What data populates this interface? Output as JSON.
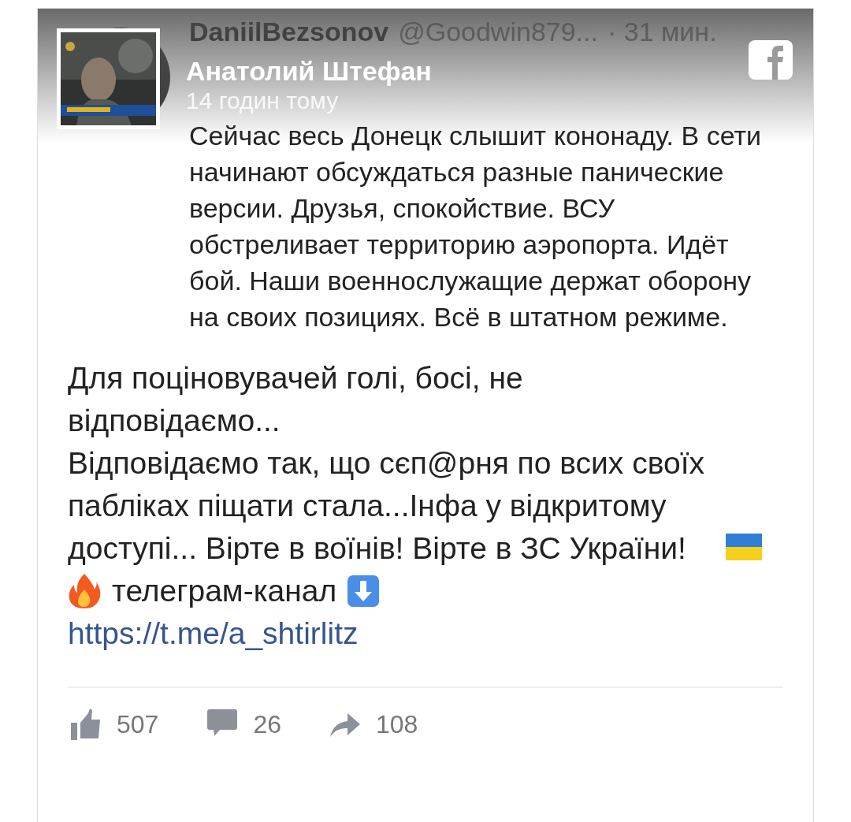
{
  "header": {
    "author": "Анатолий Штефан",
    "time": "14 годин тому"
  },
  "embedded_tweet": {
    "name": "DaniilBezsonov",
    "handle": "@Goodwin879...",
    "time": "· 31 мин.",
    "text": "Сейчас весь Донецк слышит кононаду. В сети начинают обсуждаться разные панические версии. Друзья, спокойствие. ВСУ обстреливает территорию аэропорта. Идёт бой. Наши военнослужащие держат оборону на своих позициях. Всё в штатном режиме."
  },
  "post": {
    "paragraphs": [
      "Для поціновувачей голі, босі, не відповідаємо...",
      "Відповідаємо так, що сєп@рня по всих своїх пабліках піщати стала...Інфа у відкритому доступі... Вірте в воїнів! Вірте в ЗС України!"
    ],
    "channel_label": "телеграм-канал",
    "link": "https://t.me/a_shtirlitz"
  },
  "stats": [
    {
      "kind": "likes",
      "count": "507"
    },
    {
      "kind": "comments",
      "count": "26"
    },
    {
      "kind": "shares",
      "count": "108"
    }
  ]
}
